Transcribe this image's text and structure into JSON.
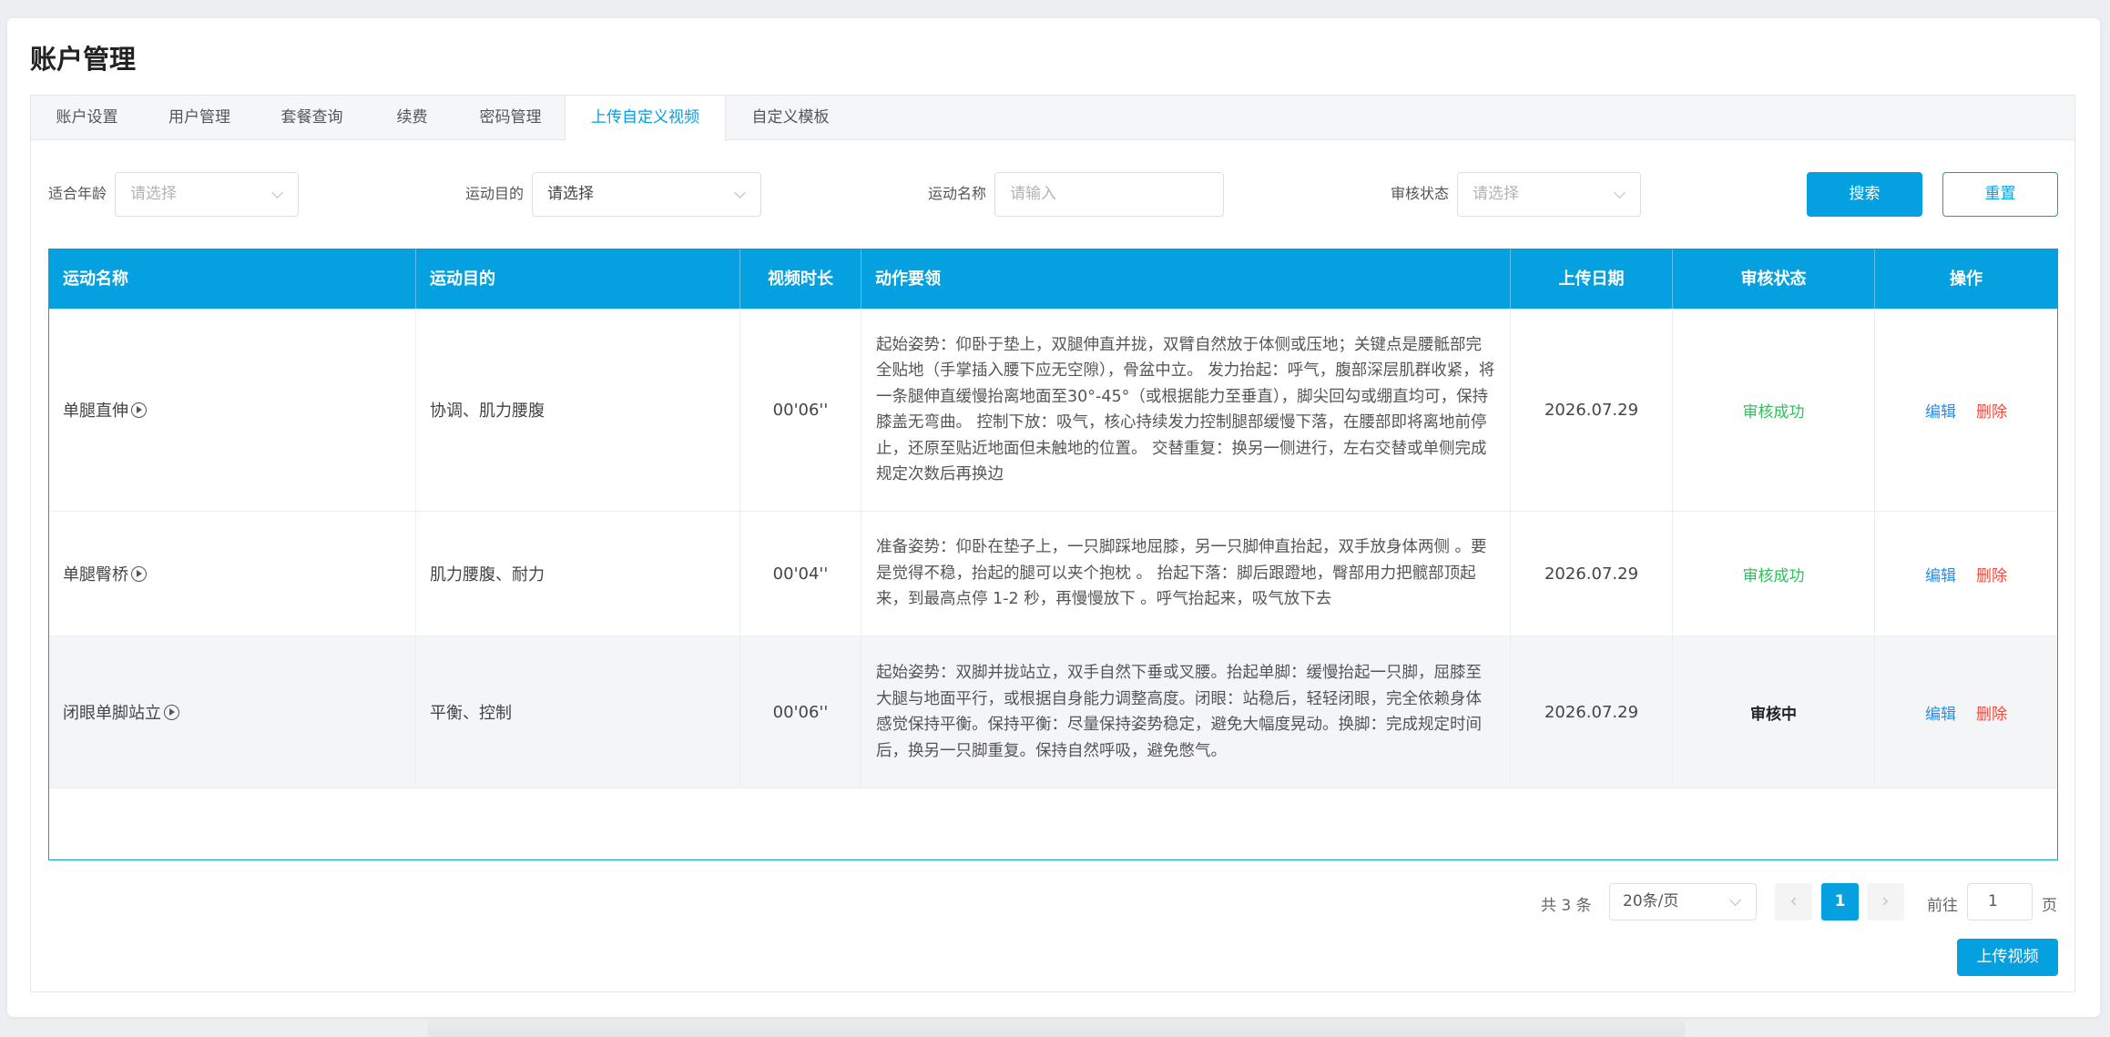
{
  "page": {
    "title": "账户管理"
  },
  "tabs": [
    {
      "label": "账户设置"
    },
    {
      "label": "用户管理"
    },
    {
      "label": "套餐查询"
    },
    {
      "label": "续费"
    },
    {
      "label": "密码管理"
    },
    {
      "label": "上传自定义视频",
      "active": true
    },
    {
      "label": "自定义模板"
    }
  ],
  "filters": {
    "age": {
      "label": "适合年龄",
      "placeholder": "请选择"
    },
    "purpose": {
      "label": "运动目的",
      "value": "请选择"
    },
    "name": {
      "label": "运动名称",
      "placeholder": "请输入"
    },
    "status": {
      "label": "审核状态",
      "placeholder": "请选择"
    },
    "search_label": "搜索",
    "reset_label": "重置"
  },
  "table": {
    "headers": [
      "运动名称",
      "运动目的",
      "视频时长",
      "动作要领",
      "上传日期",
      "审核状态",
      "操作"
    ],
    "rows": [
      {
        "name": "单腿直伸",
        "purpose": "协调、肌力腰腹",
        "duration": "00'06''",
        "description": "起始姿势：仰卧于垫上，双腿伸直并拢，双臂自然放于体侧或压地；关键点是腰骶部完全贴地（手掌插入腰下应无空隙），骨盆中立。 发力抬起：呼气，腹部深层肌群收紧，将一条腿伸直缓慢抬离地面至30°-45°（或根据能力至垂直），脚尖回勾或绷直均可，保持膝盖无弯曲。 控制下放：吸气，核心持续发力控制腿部缓慢下落，在腰部即将离地前停止，还原至贴近地面但未触地的位置。 交替重复：换另一侧进行，左右交替或单侧完成规定次数后再换边",
        "date": "2026.07.29",
        "status": "审核成功",
        "status_type": "success"
      },
      {
        "name": "单腿臀桥",
        "purpose": "肌力腰腹、耐力",
        "duration": "00'04''",
        "description": "准备姿势：仰卧在垫子上，一只脚踩地屈膝，另一只脚伸直抬起，双手放身体两侧 。要是觉得不稳，抬起的腿可以夹个抱枕 。 抬起下落：脚后跟蹬地，臀部用力把髋部顶起来，到最高点停 1-2 秒，再慢慢放下 。呼气抬起来，吸气放下去",
        "date": "2026.07.29",
        "status": "审核成功",
        "status_type": "success"
      },
      {
        "name": "闭眼单脚站立",
        "purpose": "平衡、控制",
        "duration": "00'06''",
        "description": "起始姿势：双脚并拢站立，双手自然下垂或叉腰。抬起单脚：缓慢抬起一只脚，屈膝至大腿与地面平行，或根据自身能力调整高度。闭眼：站稳后，轻轻闭眼，完全依赖身体感觉保持平衡。保持平衡：尽量保持姿势稳定，避免大幅度晃动。换脚：完成规定时间后，换另一只脚重复。保持自然呼吸，避免憋气。",
        "date": "2026.07.29",
        "status": "审核中",
        "status_type": "pending"
      }
    ],
    "action_edit": "编辑",
    "action_delete": "删除"
  },
  "pagination": {
    "total_text": "共 3 条",
    "page_size": "20条/页",
    "prev": "‹",
    "current": "1",
    "next": "›",
    "goto_label": "前往",
    "goto_value": "1",
    "page_suffix": "页"
  },
  "upload_label": "上传视频",
  "colors": {
    "accent": "#05a0df",
    "success": "#2fc25b",
    "danger": "#f5483b",
    "link": "#1890ff"
  }
}
